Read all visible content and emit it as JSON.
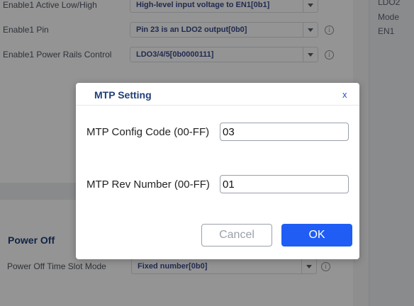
{
  "background": {
    "rows": [
      {
        "label": "Enable1 Active Low/High",
        "value": "High-level input voltage to EN1[0b1]"
      },
      {
        "label": "Enable1 Pin",
        "value": "Pin 23 is an LDO2 output[0b0]"
      },
      {
        "label": "Enable1 Power Rails Control",
        "value": "LDO3/4/5[0b0000111]"
      }
    ],
    "section_title": "Power Off",
    "power_off_row": {
      "label": "Power Off Time Slot Mode",
      "value": "Fixed number[0b0]"
    },
    "right_panel": {
      "lines": [
        "LDO2",
        "Mode",
        "EN1"
      ]
    }
  },
  "modal": {
    "title": "MTP Setting",
    "close": "x",
    "fields": [
      {
        "label": "MTP Config Code (00-FF)",
        "value": "03"
      },
      {
        "label": "MTP Rev Number (00-FF)",
        "value": "01"
      }
    ],
    "cancel_label": "Cancel",
    "ok_label": "OK"
  },
  "icons": {
    "info": "info-icon",
    "dropdown": "chevron-down-icon",
    "close": "close-icon"
  },
  "colors": {
    "accent": "#1f5df5",
    "title": "#1f3f78",
    "overlay": "rgba(0,0,0,0.42)"
  }
}
